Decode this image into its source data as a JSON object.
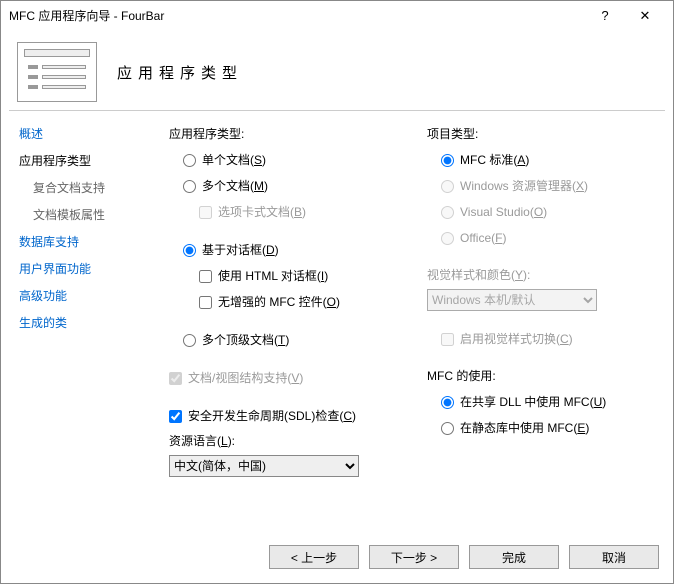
{
  "window": {
    "title": "MFC 应用程序向导 - FourBar",
    "help": "?",
    "close": "✕"
  },
  "header": {
    "title": "应用程序类型"
  },
  "sidebar": {
    "items": [
      {
        "label": "概述"
      },
      {
        "label": "应用程序类型"
      },
      {
        "label": "复合文档支持"
      },
      {
        "label": "文档模板属性"
      },
      {
        "label": "数据库支持"
      },
      {
        "label": "用户界面功能"
      },
      {
        "label": "高级功能"
      },
      {
        "label": "生成的类"
      }
    ]
  },
  "left": {
    "appTypeLabel": "应用程序类型:",
    "singleDoc": "单个文档(",
    "singleDocKey": "S",
    "singleDocEnd": ")",
    "multiDoc": "多个文档(",
    "multiDocKey": "M",
    "multiDocEnd": ")",
    "tabbedDoc": "选项卡式文档(",
    "tabbedDocKey": "B",
    "tabbedDocEnd": ")",
    "dialogBased": "基于对话框(",
    "dialogBasedKey": "D",
    "dialogBasedEnd": ")",
    "htmlDialog": "使用 HTML 对话框(",
    "htmlDialogKey": "I",
    "htmlDialogEnd": ")",
    "noEnhanced": "无增强的 MFC 控件(",
    "noEnhancedKey": "O",
    "noEnhancedEnd": ")",
    "multiTop": "多个顶级文档(",
    "multiTopKey": "T",
    "multiTopEnd": ")",
    "docView": "文档/视图结构支持(",
    "docViewKey": "V",
    "docViewEnd": ")",
    "sdl": "安全开发生命周期(SDL)检查(",
    "sdlKey": "C",
    "sdlEnd": ")",
    "resLangLabel": "资源语言(",
    "resLangKey": "L",
    "resLangEnd": "):",
    "resLangValue": "中文(简体，中国)"
  },
  "right": {
    "projTypeLabel": "项目类型:",
    "mfcStd": "MFC 标准(",
    "mfcStdKey": "A",
    "mfcStdEnd": ")",
    "winExp": "Windows 资源管理器(",
    "winExpKey": "X",
    "winExpEnd": ")",
    "vs": "Visual Studio(",
    "vsKey": "O",
    "vsEnd": ")",
    "office": "Office(",
    "officeKey": "F",
    "officeEnd": ")",
    "visualLabel": "视觉样式和颜色(",
    "visualKey": "Y",
    "visualEnd": "):",
    "visualValue": "Windows 本机/默认",
    "enableSwitch": "启用视觉样式切换(",
    "enableSwitchKey": "C",
    "enableSwitchEnd": ")",
    "mfcUseLabel": "MFC 的使用:",
    "sharedDll": "在共享 DLL 中使用 MFC(",
    "sharedDllKey": "U",
    "sharedDllEnd": ")",
    "staticLib": "在静态库中使用 MFC(",
    "staticLibKey": "E",
    "staticLibEnd": ")"
  },
  "buttons": {
    "prev": "< 上一步",
    "next": "下一步 >",
    "finish": "完成",
    "cancel": "取消"
  }
}
